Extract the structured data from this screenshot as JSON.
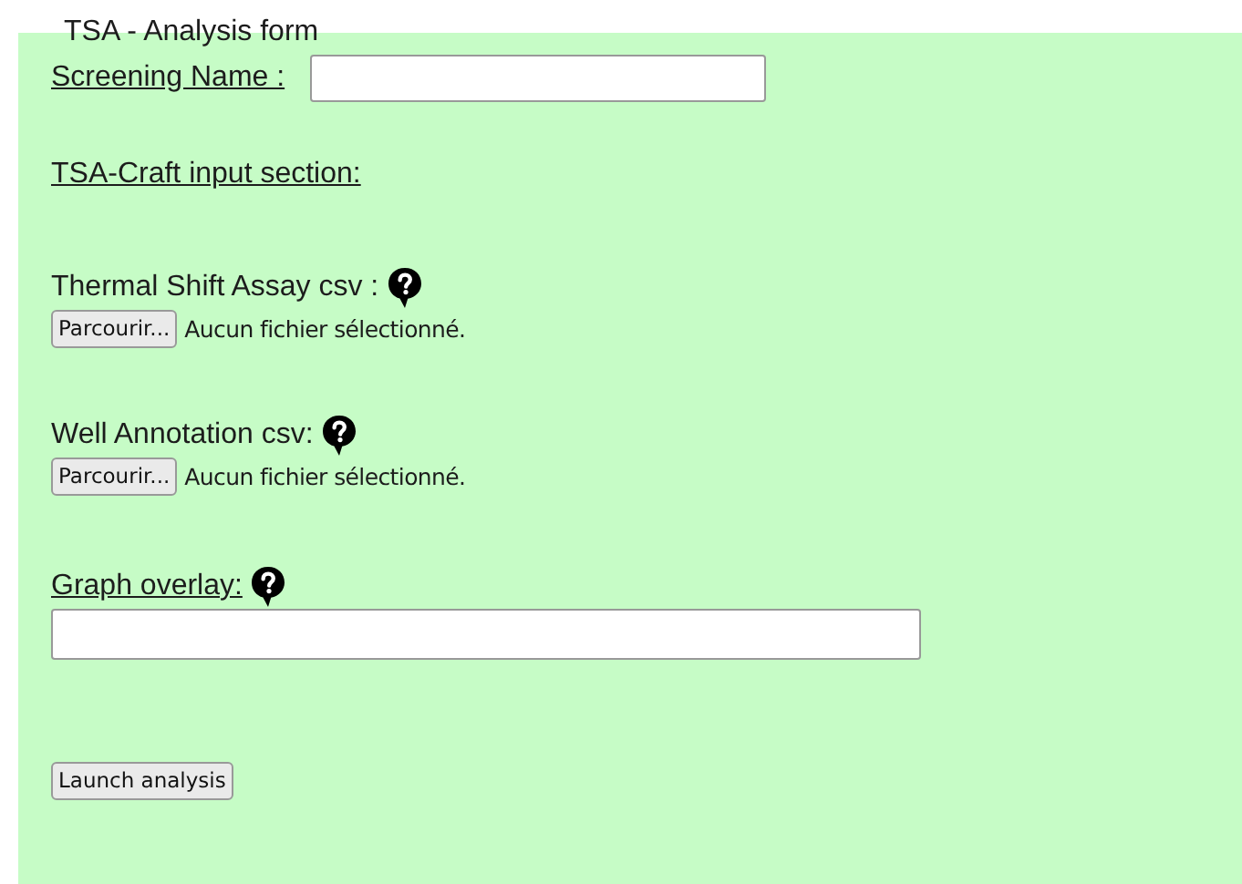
{
  "title": "TSA - Analysis form",
  "screening_name": {
    "label": "Screening Name :"
  },
  "section_heading": "TSA-Craft input section:",
  "file_inputs": [
    {
      "label": "Thermal Shift Assay csv :",
      "underlined": false,
      "button": "Parcourir...",
      "status": "Aucun fichier sélectionné."
    },
    {
      "label": "Well Annotation csv:",
      "underlined": false,
      "button": "Parcourir...",
      "status": "Aucun fichier sélectionné."
    }
  ],
  "graph_overlay": {
    "label": "Graph overlay:",
    "underlined": true
  },
  "launch_button": "Launch analysis"
}
